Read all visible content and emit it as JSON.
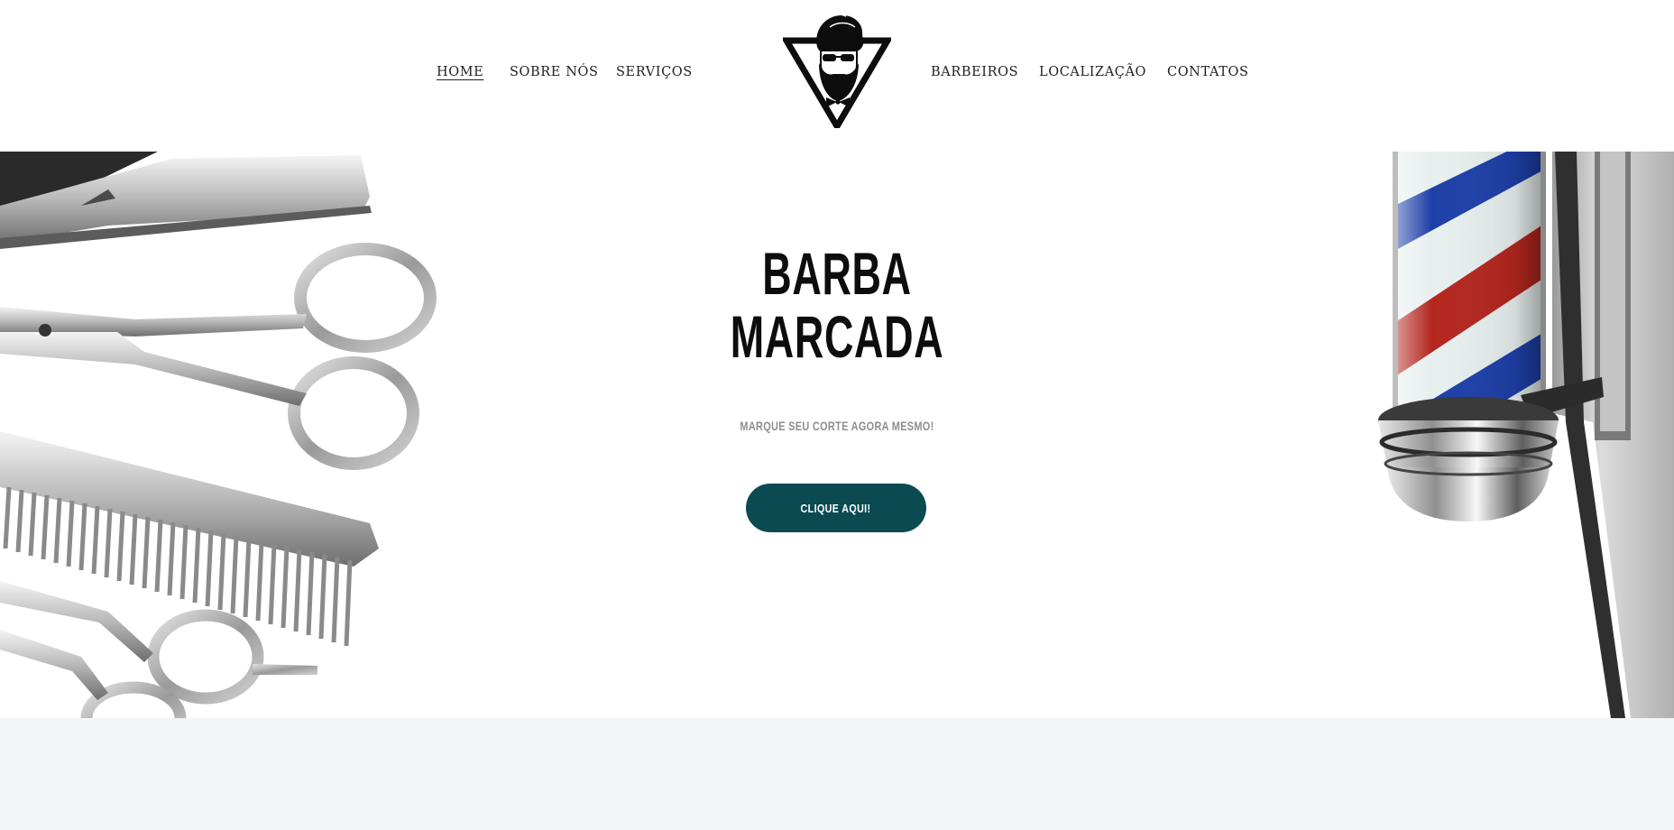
{
  "nav": {
    "left": [
      {
        "label": "HOME",
        "active": true
      },
      {
        "label": "SOBRE NÓS",
        "active": false
      },
      {
        "label": "SERVIÇOS",
        "active": false
      }
    ],
    "right": [
      {
        "label": "BARBEIROS",
        "active": false
      },
      {
        "label": "LOCALIZAÇÃO",
        "active": false
      },
      {
        "label": "CONTATOS",
        "active": false
      }
    ]
  },
  "logo": {
    "icon": "bearded-man-triangle-logo"
  },
  "hero": {
    "title_line1": "BARBA",
    "title_line2": "MARCADA",
    "subtitle": "MARQUE SEU CORTE AGORA MESMO!",
    "cta_label": "CLIQUE AQUI!",
    "left_art": "barber-tools-image",
    "right_art": "barber-pole-image"
  },
  "colors": {
    "accent": "#0c4a52",
    "text": "#1a1a1a",
    "subtitle": "#8e8e8e",
    "section_bg": "#f3f6f7"
  }
}
